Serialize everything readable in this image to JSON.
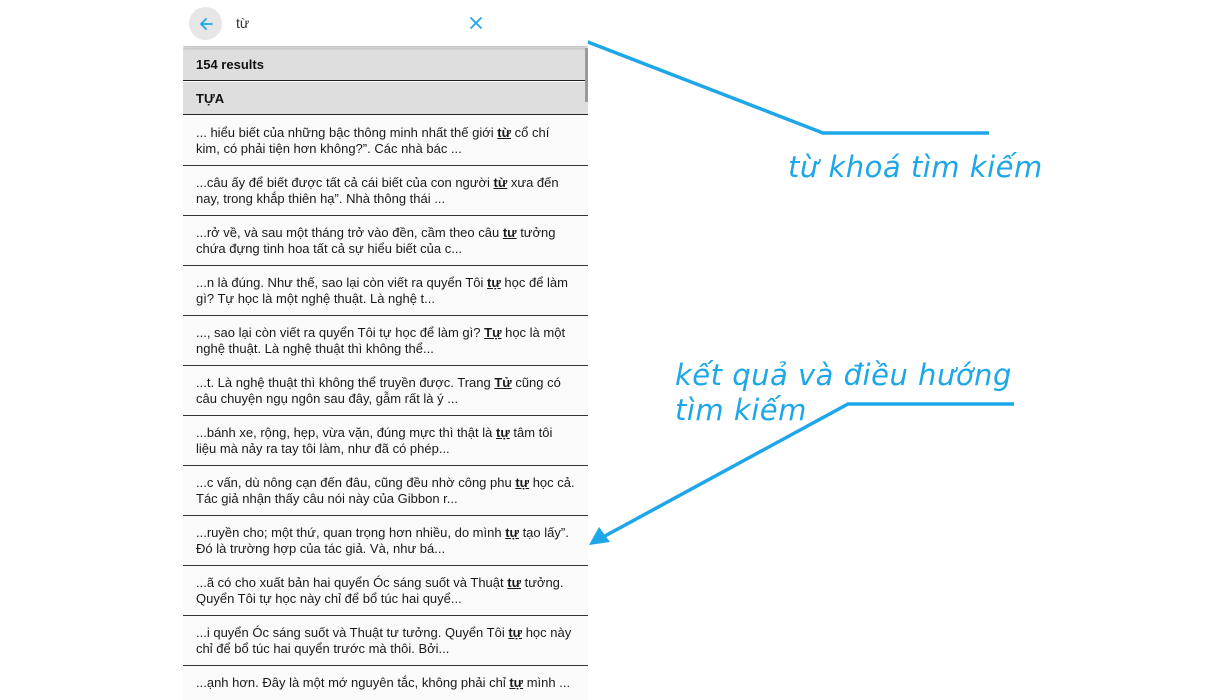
{
  "search": {
    "query": "từ"
  },
  "results": {
    "count_label": "154 results",
    "section_title": "TỰA",
    "items": [
      {
        "before": "... hiểu biết của những bậc thông minh nhất thế giới ",
        "match": "từ",
        "after": " cổ chí kim, có phải tiện hơn không?”. Các nhà bác ..."
      },
      {
        "before": "...câu ấy để biết được tất cả cái biết của con người ",
        "match": "từ",
        "after": " xưa đến nay, trong khắp thiên hạ”. Nhà thông thái ..."
      },
      {
        "before": "...rở về, và sau một tháng trở vào đền, cầm theo câu ",
        "match": "tư",
        "after": " tưởng chứa đựng tinh hoa tất cả sự hiểu biết của c..."
      },
      {
        "before": "...n là đúng. Như thế, sao lại còn viết ra quyển Tôi ",
        "match": "tự",
        "after": " học để làm gì? Tự học là một nghệ thuật. Là nghệ t..."
      },
      {
        "before": "..., sao lại còn viết ra quyển Tôi tự học để làm gì? ",
        "match": "Tự",
        "after": " học là một nghệ thuật. Là nghệ thuật thì không thể..."
      },
      {
        "before": "...t. Là nghệ thuật thì không thể truyền được. Trang ",
        "match": "Tử",
        "after": " cũng có câu chuyện ngụ ngôn sau đây, gẫm rất là ý ..."
      },
      {
        "before": "...bánh xe, rộng, hẹp, vừa vặn, đúng mực thì thật là ",
        "match": "tự",
        "after": " tâm tôi liệu mà nảy ra tay tôi làm, như đã có phép..."
      },
      {
        "before": "...c vấn, dù nông cạn đến đâu, cũng đều nhờ công phu ",
        "match": "tự",
        "after": " học cả. Tác giả nhận thấy câu nói này của Gibbon r..."
      },
      {
        "before": "...ruyền cho; một thứ, quan trọng hơn nhiều, do mình ",
        "match": "tự",
        "after": " tạo lấy”. Đó là trường hợp của tác giả. Và, như bá..."
      },
      {
        "before": "...ã có cho xuất bản hai quyển Óc sáng suốt và Thuật ",
        "match": "tư",
        "after": " tưởng. Quyển Tôi tự học này chỉ để bổ túc hai quyể..."
      },
      {
        "before": "...i quyển Óc sáng suốt và Thuật tư tưởng. Quyển Tôi ",
        "match": "tự",
        "after": " học này chỉ để bổ túc hai quyển trước mà thôi. Bởi..."
      },
      {
        "before": "...ạnh hơn. Đây là một mớ nguyên tắc, không phải chỉ ",
        "match": "tự",
        "after": " mình ..."
      }
    ]
  },
  "annotations": {
    "search_keyword": "từ khoá tìm kiếm",
    "results_line1": "kết quả và điều hướng",
    "results_line2": "tìm kiếm"
  },
  "icons": {
    "back": "arrow-left-icon",
    "clear": "close-icon"
  },
  "colors": {
    "accent": "#1ea7e8",
    "header_bg": "#dedede",
    "back_button_bg": "#e6e6e6"
  }
}
